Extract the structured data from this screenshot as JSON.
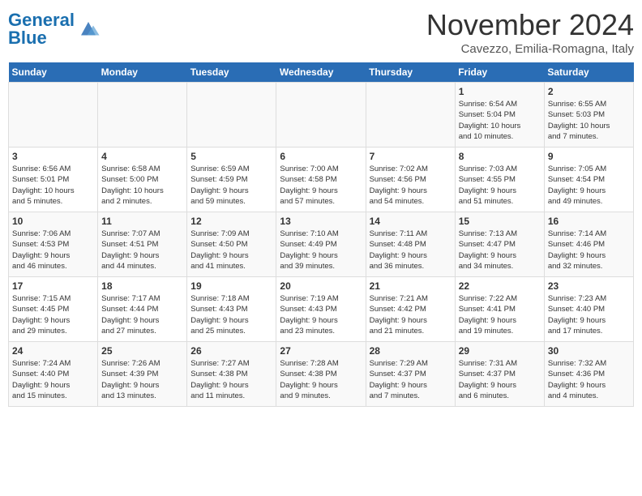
{
  "header": {
    "logo_general": "General",
    "logo_blue": "Blue",
    "month_title": "November 2024",
    "location": "Cavezzo, Emilia-Romagna, Italy"
  },
  "days_of_week": [
    "Sunday",
    "Monday",
    "Tuesday",
    "Wednesday",
    "Thursday",
    "Friday",
    "Saturday"
  ],
  "weeks": [
    [
      {
        "day": "",
        "info": ""
      },
      {
        "day": "",
        "info": ""
      },
      {
        "day": "",
        "info": ""
      },
      {
        "day": "",
        "info": ""
      },
      {
        "day": "",
        "info": ""
      },
      {
        "day": "1",
        "info": "Sunrise: 6:54 AM\nSunset: 5:04 PM\nDaylight: 10 hours\nand 10 minutes."
      },
      {
        "day": "2",
        "info": "Sunrise: 6:55 AM\nSunset: 5:03 PM\nDaylight: 10 hours\nand 7 minutes."
      }
    ],
    [
      {
        "day": "3",
        "info": "Sunrise: 6:56 AM\nSunset: 5:01 PM\nDaylight: 10 hours\nand 5 minutes."
      },
      {
        "day": "4",
        "info": "Sunrise: 6:58 AM\nSunset: 5:00 PM\nDaylight: 10 hours\nand 2 minutes."
      },
      {
        "day": "5",
        "info": "Sunrise: 6:59 AM\nSunset: 4:59 PM\nDaylight: 9 hours\nand 59 minutes."
      },
      {
        "day": "6",
        "info": "Sunrise: 7:00 AM\nSunset: 4:58 PM\nDaylight: 9 hours\nand 57 minutes."
      },
      {
        "day": "7",
        "info": "Sunrise: 7:02 AM\nSunset: 4:56 PM\nDaylight: 9 hours\nand 54 minutes."
      },
      {
        "day": "8",
        "info": "Sunrise: 7:03 AM\nSunset: 4:55 PM\nDaylight: 9 hours\nand 51 minutes."
      },
      {
        "day": "9",
        "info": "Sunrise: 7:05 AM\nSunset: 4:54 PM\nDaylight: 9 hours\nand 49 minutes."
      }
    ],
    [
      {
        "day": "10",
        "info": "Sunrise: 7:06 AM\nSunset: 4:53 PM\nDaylight: 9 hours\nand 46 minutes."
      },
      {
        "day": "11",
        "info": "Sunrise: 7:07 AM\nSunset: 4:51 PM\nDaylight: 9 hours\nand 44 minutes."
      },
      {
        "day": "12",
        "info": "Sunrise: 7:09 AM\nSunset: 4:50 PM\nDaylight: 9 hours\nand 41 minutes."
      },
      {
        "day": "13",
        "info": "Sunrise: 7:10 AM\nSunset: 4:49 PM\nDaylight: 9 hours\nand 39 minutes."
      },
      {
        "day": "14",
        "info": "Sunrise: 7:11 AM\nSunset: 4:48 PM\nDaylight: 9 hours\nand 36 minutes."
      },
      {
        "day": "15",
        "info": "Sunrise: 7:13 AM\nSunset: 4:47 PM\nDaylight: 9 hours\nand 34 minutes."
      },
      {
        "day": "16",
        "info": "Sunrise: 7:14 AM\nSunset: 4:46 PM\nDaylight: 9 hours\nand 32 minutes."
      }
    ],
    [
      {
        "day": "17",
        "info": "Sunrise: 7:15 AM\nSunset: 4:45 PM\nDaylight: 9 hours\nand 29 minutes."
      },
      {
        "day": "18",
        "info": "Sunrise: 7:17 AM\nSunset: 4:44 PM\nDaylight: 9 hours\nand 27 minutes."
      },
      {
        "day": "19",
        "info": "Sunrise: 7:18 AM\nSunset: 4:43 PM\nDaylight: 9 hours\nand 25 minutes."
      },
      {
        "day": "20",
        "info": "Sunrise: 7:19 AM\nSunset: 4:43 PM\nDaylight: 9 hours\nand 23 minutes."
      },
      {
        "day": "21",
        "info": "Sunrise: 7:21 AM\nSunset: 4:42 PM\nDaylight: 9 hours\nand 21 minutes."
      },
      {
        "day": "22",
        "info": "Sunrise: 7:22 AM\nSunset: 4:41 PM\nDaylight: 9 hours\nand 19 minutes."
      },
      {
        "day": "23",
        "info": "Sunrise: 7:23 AM\nSunset: 4:40 PM\nDaylight: 9 hours\nand 17 minutes."
      }
    ],
    [
      {
        "day": "24",
        "info": "Sunrise: 7:24 AM\nSunset: 4:40 PM\nDaylight: 9 hours\nand 15 minutes."
      },
      {
        "day": "25",
        "info": "Sunrise: 7:26 AM\nSunset: 4:39 PM\nDaylight: 9 hours\nand 13 minutes."
      },
      {
        "day": "26",
        "info": "Sunrise: 7:27 AM\nSunset: 4:38 PM\nDaylight: 9 hours\nand 11 minutes."
      },
      {
        "day": "27",
        "info": "Sunrise: 7:28 AM\nSunset: 4:38 PM\nDaylight: 9 hours\nand 9 minutes."
      },
      {
        "day": "28",
        "info": "Sunrise: 7:29 AM\nSunset: 4:37 PM\nDaylight: 9 hours\nand 7 minutes."
      },
      {
        "day": "29",
        "info": "Sunrise: 7:31 AM\nSunset: 4:37 PM\nDaylight: 9 hours\nand 6 minutes."
      },
      {
        "day": "30",
        "info": "Sunrise: 7:32 AM\nSunset: 4:36 PM\nDaylight: 9 hours\nand 4 minutes."
      }
    ]
  ]
}
